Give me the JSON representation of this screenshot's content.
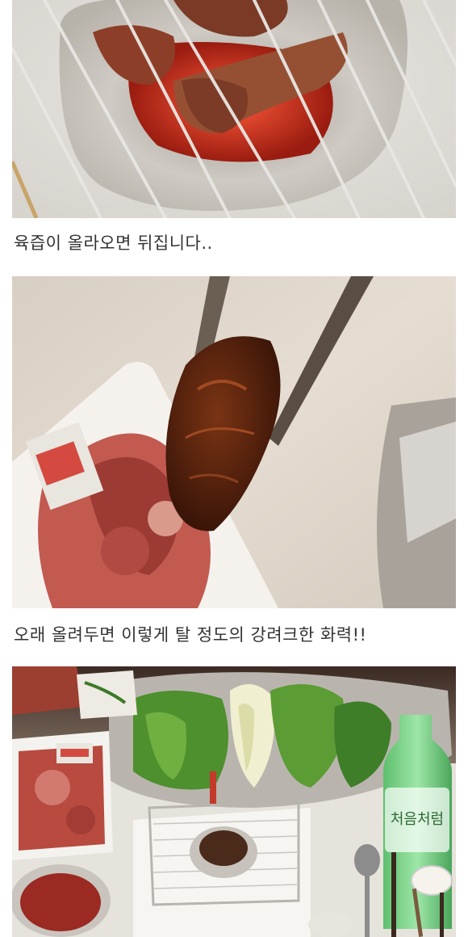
{
  "post": {
    "captions": [
      "육즙이 올라오면 뒤집니다..",
      "오래 올려두면 이렇게 탈 정도의 강려크한 화력!!"
    ],
    "bottle_label": "처음처럼"
  },
  "colors": {
    "foil": "#c9c6c0",
    "meat": "#8a3a22",
    "ember": "#e0402a",
    "lettuce": "#5f9a3a",
    "soju_bottle": "#7fcf8a",
    "tray": "#f1efec"
  }
}
